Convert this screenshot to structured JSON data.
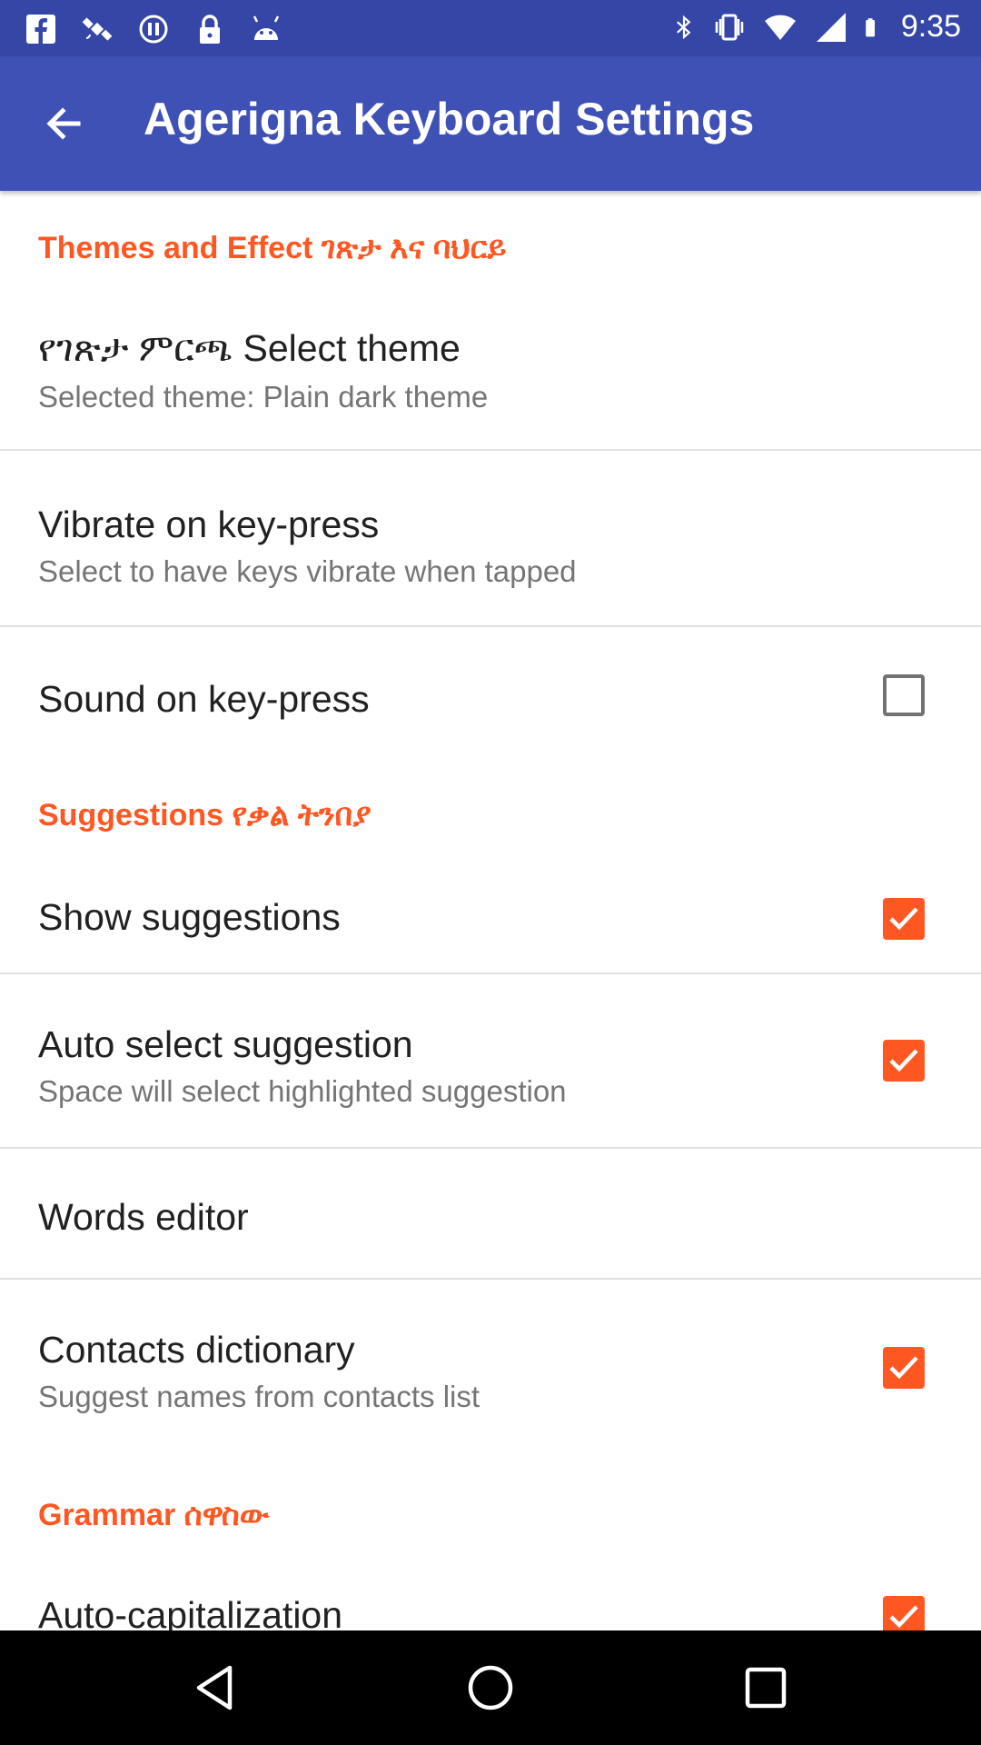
{
  "status_bar": {
    "time": "9:35",
    "left_icons": [
      "facebook-icon",
      "satellite-icon",
      "sync-icon",
      "lock-icon",
      "android-icon"
    ],
    "right_icons": [
      "bluetooth-icon",
      "vibrate-icon",
      "wifi-icon",
      "signal-icon",
      "battery-icon"
    ]
  },
  "app_bar": {
    "title": "Agerigna Keyboard Settings",
    "back_icon": "arrow-back-icon"
  },
  "colors": {
    "primary": "#3f51b5",
    "primary_dark": "#3646a6",
    "accent": "#ff5722"
  },
  "sections": {
    "themes": {
      "header": "Themes and Effect ገጽታ እና ባህርይ",
      "select_theme": {
        "title": "የገጽታ ምርጫ Select theme",
        "summary": "Selected theme: Plain dark theme"
      },
      "vibrate": {
        "title": "Vibrate on key-press",
        "summary": "Select to have keys vibrate when tapped"
      },
      "sound": {
        "title": "Sound on key-press",
        "checked": false
      }
    },
    "suggestions": {
      "header": "Suggestions የቃል ትንበያ",
      "show": {
        "title": "Show suggestions",
        "checked": true
      },
      "auto_select": {
        "title": "Auto select suggestion",
        "summary": "Space will select highlighted suggestion",
        "checked": true
      },
      "words_editor": {
        "title": "Words editor"
      },
      "contacts": {
        "title": "Contacts dictionary",
        "summary": "Suggest names from contacts list",
        "checked": true
      }
    },
    "grammar": {
      "header": "Grammar ሰዋስው",
      "auto_cap": {
        "title": "Auto-capitalization",
        "checked": true
      }
    }
  },
  "nav_bar": {
    "buttons": [
      "back-triangle-icon",
      "home-circle-icon",
      "recents-square-icon"
    ]
  }
}
